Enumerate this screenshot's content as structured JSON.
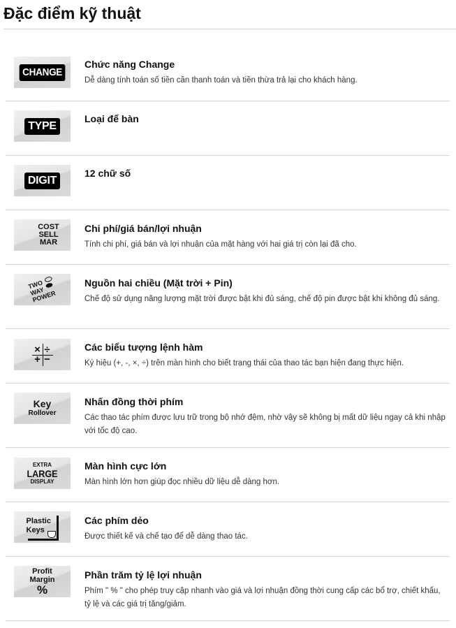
{
  "page": {
    "title": "Đặc điểm kỹ thuật"
  },
  "features": [
    {
      "icon": "change-icon",
      "icon_text": [
        "CHANGE"
      ],
      "title": "Chức năng Change",
      "description": "Dễ dàng tính toán số tiền cần thanh toán và tiền thừa trả lại cho khách hàng."
    },
    {
      "icon": "type-icon",
      "icon_text": [
        "TYPE"
      ],
      "title": "Loại để bàn",
      "description": ""
    },
    {
      "icon": "digit-icon",
      "icon_text": [
        "DIGIT"
      ],
      "title": "12 chữ số",
      "description": ""
    },
    {
      "icon": "cost-sell-margin-icon",
      "icon_text": [
        "COST",
        "SELL",
        "MAR"
      ],
      "title": "Chi phí/giá bán/lợi nhuận",
      "description": "Tính chi phí, giá bán và lợi nhuận của mặt hàng với hai giá trị còn lại đã cho."
    },
    {
      "icon": "two-way-power-icon",
      "icon_text": [
        "TWO",
        "WAY",
        "POWER"
      ],
      "title": "Nguồn hai chiều (Mặt trời + Pin)",
      "description": "Chế độ sử dụng năng lượng mặt trời được bật khi đủ sáng, chế độ pin được bật khi không đủ sáng."
    },
    {
      "icon": "operator-symbols-icon",
      "icon_text": [
        "×",
        "÷",
        "+",
        "−"
      ],
      "title": "Các biểu tượng lệnh hàm",
      "description": "Ký hiệu (+, -, ×, ÷) trên màn hình cho biết trạng thái của thao tác bạn hiện đang thực hiện."
    },
    {
      "icon": "key-rollover-icon",
      "icon_text": [
        "Key",
        "Rollover"
      ],
      "title": "Nhấn đồng thời phím",
      "description": "Các thao tác phím được lưu trữ trong bộ nhớ đệm, nhờ vậy sẽ không bị mất dữ liệu ngay cả khi nhập với tốc độ cao."
    },
    {
      "icon": "extra-large-display-icon",
      "icon_text": [
        "EXTRA",
        "LARGE",
        "DISPLAY"
      ],
      "title": "Màn hình cực lớn",
      "description": "Màn hình lớn hơn giúp đọc nhiều dữ liệu dễ dàng hơn."
    },
    {
      "icon": "plastic-keys-icon",
      "icon_text": [
        "Plastic",
        "Keys"
      ],
      "title": "Các phím dẻo",
      "description": "Được thiết kế và chế tạo để dễ dàng thao tác."
    },
    {
      "icon": "profit-margin-icon",
      "icon_text": [
        "Profit",
        "Margin",
        "%"
      ],
      "title": "Phần trăm tỷ lệ lợi nhuận",
      "description": "Phím \" % \" cho phép truy cập nhanh vào giá và lợi nhuận đồng thời cung cấp các bổ trợ, chiết khấu, tỷ lệ và các giá trị tăng/giảm."
    }
  ]
}
